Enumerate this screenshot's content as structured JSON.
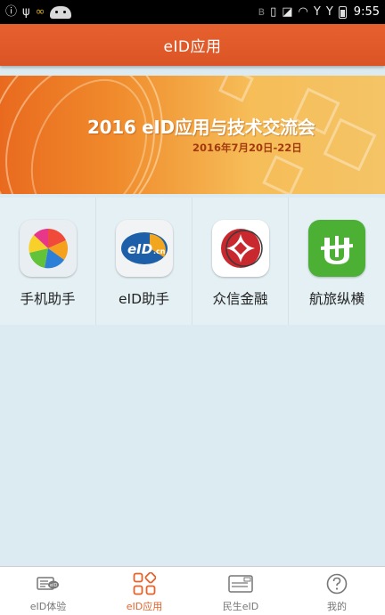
{
  "status_bar": {
    "time": "9:55",
    "left_icons": [
      "info-icon",
      "usb-icon",
      "glasses-icon",
      "android-icon"
    ],
    "right_icons": [
      "bluetooth-icon",
      "vibrate-icon",
      "sim-icon",
      "wifi-icon",
      "signal-icon",
      "signal-icon",
      "battery-icon"
    ]
  },
  "header": {
    "title": "eID应用"
  },
  "banner": {
    "title": "2016 eID应用与技术交流会",
    "date": "2016年7月20日-22日"
  },
  "apps": [
    {
      "label": "手机助手",
      "icon": "phone-assistant-icon"
    },
    {
      "label": "eID助手",
      "icon": "eid-assistant-icon"
    },
    {
      "label": "众信金融",
      "icon": "zhongxin-finance-icon"
    },
    {
      "label": "航旅纵横",
      "icon": "hanglv-zongheng-icon"
    }
  ],
  "bottom_nav": {
    "items": [
      {
        "label": "eID体验",
        "icon": "eid-card-icon",
        "active": false
      },
      {
        "label": "eID应用",
        "icon": "grid-apps-icon",
        "active": true
      },
      {
        "label": "民生eID",
        "icon": "id-card-icon",
        "active": false
      },
      {
        "label": "我的",
        "icon": "help-circle-icon",
        "active": false
      }
    ]
  },
  "colors": {
    "accent": "#e4632a",
    "header_bg": "#e05a28",
    "page_bg": "#dcebf1",
    "grid_cell_bg": "#e4f0f4"
  }
}
